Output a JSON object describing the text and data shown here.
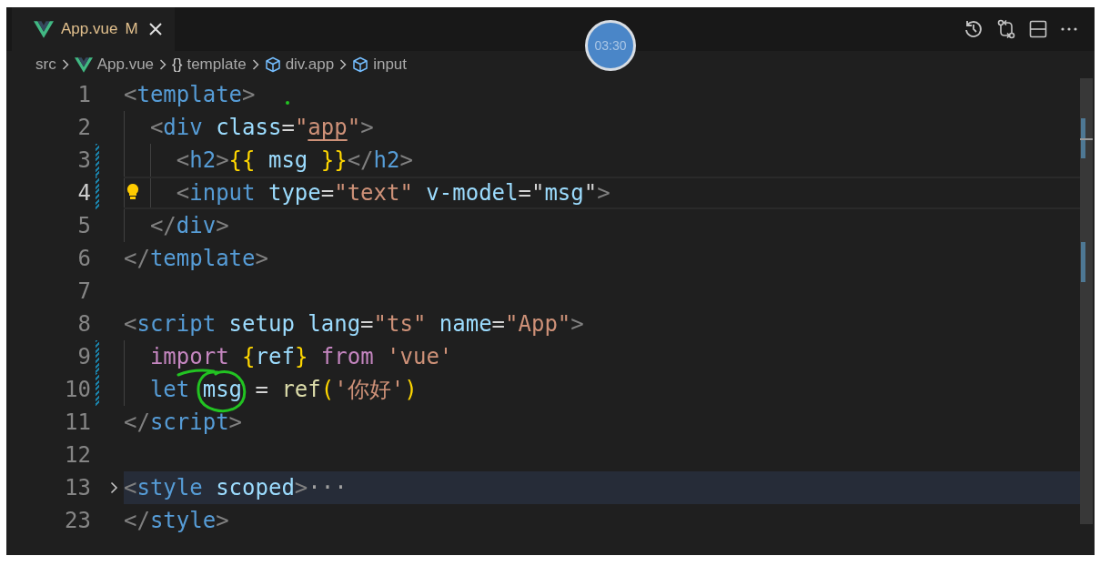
{
  "tab": {
    "label": "App.vue",
    "status": "M",
    "selected": true,
    "modified": true
  },
  "timer": "03:30",
  "actions": [
    {
      "kind": "history"
    },
    {
      "kind": "compare"
    },
    {
      "kind": "split"
    },
    {
      "kind": "more"
    }
  ],
  "breadcrumbs": [
    {
      "kind": "folder",
      "label": "src"
    },
    {
      "kind": "vue",
      "label": "App.vue"
    },
    {
      "kind": "symbol",
      "icon": "{}",
      "label": "template"
    },
    {
      "kind": "element",
      "label": "div.app"
    },
    {
      "kind": "element",
      "label": "input"
    }
  ],
  "lines": [
    {
      "number": "1",
      "active": false,
      "modified": false,
      "lightbulb": false,
      "folded": false,
      "tokens": [
        {
          "kind": "punct",
          "text": "<"
        },
        {
          "kind": "tag",
          "text": "template"
        },
        {
          "kind": "punct",
          "text": ">"
        }
      ]
    },
    {
      "number": "2",
      "active": false,
      "modified": false,
      "lightbulb": false,
      "folded": false,
      "tokens": [
        {
          "kind": "punct",
          "text": "  <"
        },
        {
          "kind": "tag",
          "text": "div"
        },
        {
          "kind": "attr",
          "text": " class"
        },
        {
          "kind": "plain",
          "text": "="
        },
        {
          "kind": "string",
          "text": "\""
        },
        {
          "kind": "string-underlined",
          "text": "app"
        },
        {
          "kind": "string",
          "text": "\""
        },
        {
          "kind": "punct",
          "text": ">"
        }
      ]
    },
    {
      "number": "3",
      "active": false,
      "modified": true,
      "lightbulb": false,
      "folded": false,
      "tokens": [
        {
          "kind": "punct",
          "text": "    <"
        },
        {
          "kind": "tag",
          "text": "h2"
        },
        {
          "kind": "punct",
          "text": ">"
        },
        {
          "kind": "brace",
          "text": "{{"
        },
        {
          "kind": "var",
          "text": " msg "
        },
        {
          "kind": "brace",
          "text": "}}"
        },
        {
          "kind": "punct",
          "text": "</"
        },
        {
          "kind": "tag",
          "text": "h2"
        },
        {
          "kind": "punct",
          "text": ">"
        }
      ]
    },
    {
      "number": "4",
      "active": true,
      "modified": true,
      "lightbulb": true,
      "folded": false,
      "tokens": [
        {
          "kind": "punct",
          "text": "    <"
        },
        {
          "kind": "tag",
          "text": "input"
        },
        {
          "kind": "attr",
          "text": " type"
        },
        {
          "kind": "plain",
          "text": "="
        },
        {
          "kind": "string",
          "text": "\"text\""
        },
        {
          "kind": "attr",
          "text": " v-model"
        },
        {
          "kind": "plain",
          "text": "=\""
        },
        {
          "kind": "var",
          "text": "msg"
        },
        {
          "kind": "plain",
          "text": "\""
        },
        {
          "kind": "punct",
          "text": ">"
        }
      ]
    },
    {
      "number": "5",
      "active": false,
      "modified": false,
      "lightbulb": false,
      "folded": false,
      "tokens": [
        {
          "kind": "punct",
          "text": "  </"
        },
        {
          "kind": "tag",
          "text": "div"
        },
        {
          "kind": "punct",
          "text": ">"
        }
      ]
    },
    {
      "number": "6",
      "active": false,
      "modified": false,
      "lightbulb": false,
      "folded": false,
      "tokens": [
        {
          "kind": "punct",
          "text": "</"
        },
        {
          "kind": "tag",
          "text": "template"
        },
        {
          "kind": "punct",
          "text": ">"
        }
      ]
    },
    {
      "number": "7",
      "active": false,
      "modified": false,
      "lightbulb": false,
      "folded": false
    },
    {
      "number": "8",
      "active": false,
      "modified": false,
      "lightbulb": false,
      "folded": false,
      "tokens": [
        {
          "kind": "punct",
          "text": "<"
        },
        {
          "kind": "tag",
          "text": "script"
        },
        {
          "kind": "attr",
          "text": " setup lang"
        },
        {
          "kind": "plain",
          "text": "="
        },
        {
          "kind": "string",
          "text": "\"ts\""
        },
        {
          "kind": "attr",
          "text": " name"
        },
        {
          "kind": "plain",
          "text": "="
        },
        {
          "kind": "string",
          "text": "\"App\""
        },
        {
          "kind": "punct",
          "text": ">"
        }
      ]
    },
    {
      "number": "9",
      "active": false,
      "modified": true,
      "lightbulb": false,
      "folded": false,
      "tokens": [
        {
          "kind": "keyword",
          "text": "  import "
        },
        {
          "kind": "brace",
          "text": "{"
        },
        {
          "kind": "var",
          "text": "ref"
        },
        {
          "kind": "brace",
          "text": "}"
        },
        {
          "kind": "keyword",
          "text": " from"
        },
        {
          "kind": "string",
          "text": " 'vue'"
        }
      ]
    },
    {
      "number": "10",
      "active": false,
      "modified": true,
      "lightbulb": false,
      "folded": false,
      "tokens": [
        {
          "kind": "storage",
          "text": "  let"
        },
        {
          "kind": "var",
          "text": " msg"
        },
        {
          "kind": "plain",
          "text": " = "
        },
        {
          "kind": "func",
          "text": "ref"
        },
        {
          "kind": "brace",
          "text": "("
        },
        {
          "kind": "string",
          "text": "'你好'"
        },
        {
          "kind": "brace",
          "text": ")"
        }
      ]
    },
    {
      "number": "11",
      "active": false,
      "modified": false,
      "lightbulb": false,
      "folded": false,
      "tokens": [
        {
          "kind": "punct",
          "text": "</"
        },
        {
          "kind": "tag",
          "text": "script"
        },
        {
          "kind": "punct",
          "text": ">"
        }
      ]
    },
    {
      "number": "12",
      "active": false,
      "modified": false,
      "lightbulb": false,
      "folded": false
    },
    {
      "number": "13",
      "active": false,
      "modified": false,
      "lightbulb": false,
      "folded": true,
      "tokens": [
        {
          "kind": "punct",
          "text": "<"
        },
        {
          "kind": "tag",
          "text": "style"
        },
        {
          "kind": "attr",
          "text": " scoped"
        },
        {
          "kind": "punct",
          "text": ">"
        },
        {
          "kind": "ellipsis",
          "text": "···"
        }
      ]
    },
    {
      "number": "23",
      "active": false,
      "modified": false,
      "lightbulb": false,
      "folded": false,
      "tokens": [
        {
          "kind": "punct",
          "text": "</"
        },
        {
          "kind": "tag",
          "text": "style"
        },
        {
          "kind": "punct",
          "text": ">"
        }
      ]
    }
  ]
}
